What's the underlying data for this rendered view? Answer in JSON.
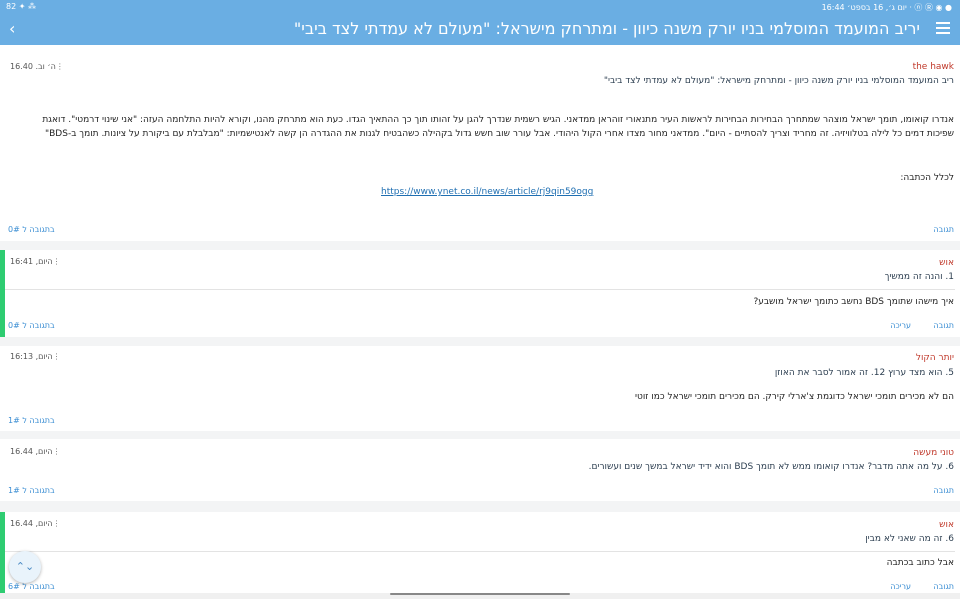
{
  "status_bar": {
    "left": "82 ✦ ⁂",
    "right": "יום ג׳, 16 בספט׳ 16:44 · ⓝ Ⓡ ◉ ●"
  },
  "app_bar": {
    "title": "יריב המועמד המוסלמי בניו יורק משנה כיוון - ומתרחק מישראל: \"מעולם לא עמדתי לצד ביבי\"",
    "back_icon": "chevron-left-icon",
    "menu_icon": "hamburger-icon"
  },
  "post": {
    "author": "the hawk",
    "time": "ה׳ וב. 16.40",
    "title": "ריב המועמד המוסלמי בניו יורק משנה כיוון - ומתרחק מישראל: \"מעולם לא עמדתי לצד ביבי\"",
    "body_line1": "אנדרו קואומו, תומך ישראל מוצהר שמתחרך הבחירות הבחירות לראשות העיר מתנאורי זוהראן ממדאני. הגיש רשמית שנדרך להגן על זהותו תוך כך ההתאיך הגדו. כעת הוא מתרחק מהנו, וקורא להיות התלחמה העזה: \"אני שינוי דרמטי\". דואגת",
    "body_line2": "שפיכות דמים כל לילה בטלוויזיה. זה מחריד וצריך להסתיים - היום\". ממדאני מחור מצדו אחרי הקול היהודי. אבל עורר שוב חשש גדול בקהילה כשהבטיח לגנות את ההגדרה הן קשה לאנטישמיות: \"מבלבלת עם ביקורת על ציונות. תומך ב-BDS\"",
    "full_article_label": "לכלל הכתבה:",
    "link": "https://www.ynet.co.il/news/article/rj9qin59ogg",
    "reply": "תגובה",
    "reply_to": "בתגובה ל 0#"
  },
  "comments": [
    {
      "author": "אוש",
      "time": "היום, 16:41",
      "title": "1. והנה זה ממשיך",
      "body": "איך מישהו שתומך BDS נחשב כתומך ישראל מושבע?",
      "reply": "תגובה",
      "edit": "עריכה",
      "reply_to": "בתגובה ל 0#"
    },
    {
      "author": "יותר הקול",
      "time": "היום, 16:13",
      "title": "5. הוא מצד ערוץ 12. זה אמור לסבר את האוזן",
      "body": "הם לא מכירים תומכי ישראל כדוגמת צ'ארלי קירק. הם מכירים תומכי ישראל כמו זוטי",
      "reply_to": "בתגובה ל 1#"
    },
    {
      "author": "טוני מעשה",
      "time": "היום, 16.44",
      "title": "6. על מה אתה מדבר? אנדרו קואומו ממש לא תומך BDS והוא ידיד ישראל במשך שנים ועשורים.",
      "reply": "תגובה",
      "reply_to": "בתגובה ל 1#"
    },
    {
      "author": "אוש",
      "time": "היום, 16.44",
      "title": "6. זה מה שאני לא מבין",
      "body": "אבל כתוב בכתבה",
      "reply": "תגובה",
      "edit": "עריכה",
      "reply_to": "בתגובה ל 6#"
    }
  ],
  "fab": {
    "icon": "scroll-arrows-icon",
    "glyph": "⌃⌄"
  },
  "colors": {
    "appbar": "#6aaee3",
    "accent": "#2ecc71",
    "author": "#c0392b",
    "link": "#1f6fb2"
  }
}
